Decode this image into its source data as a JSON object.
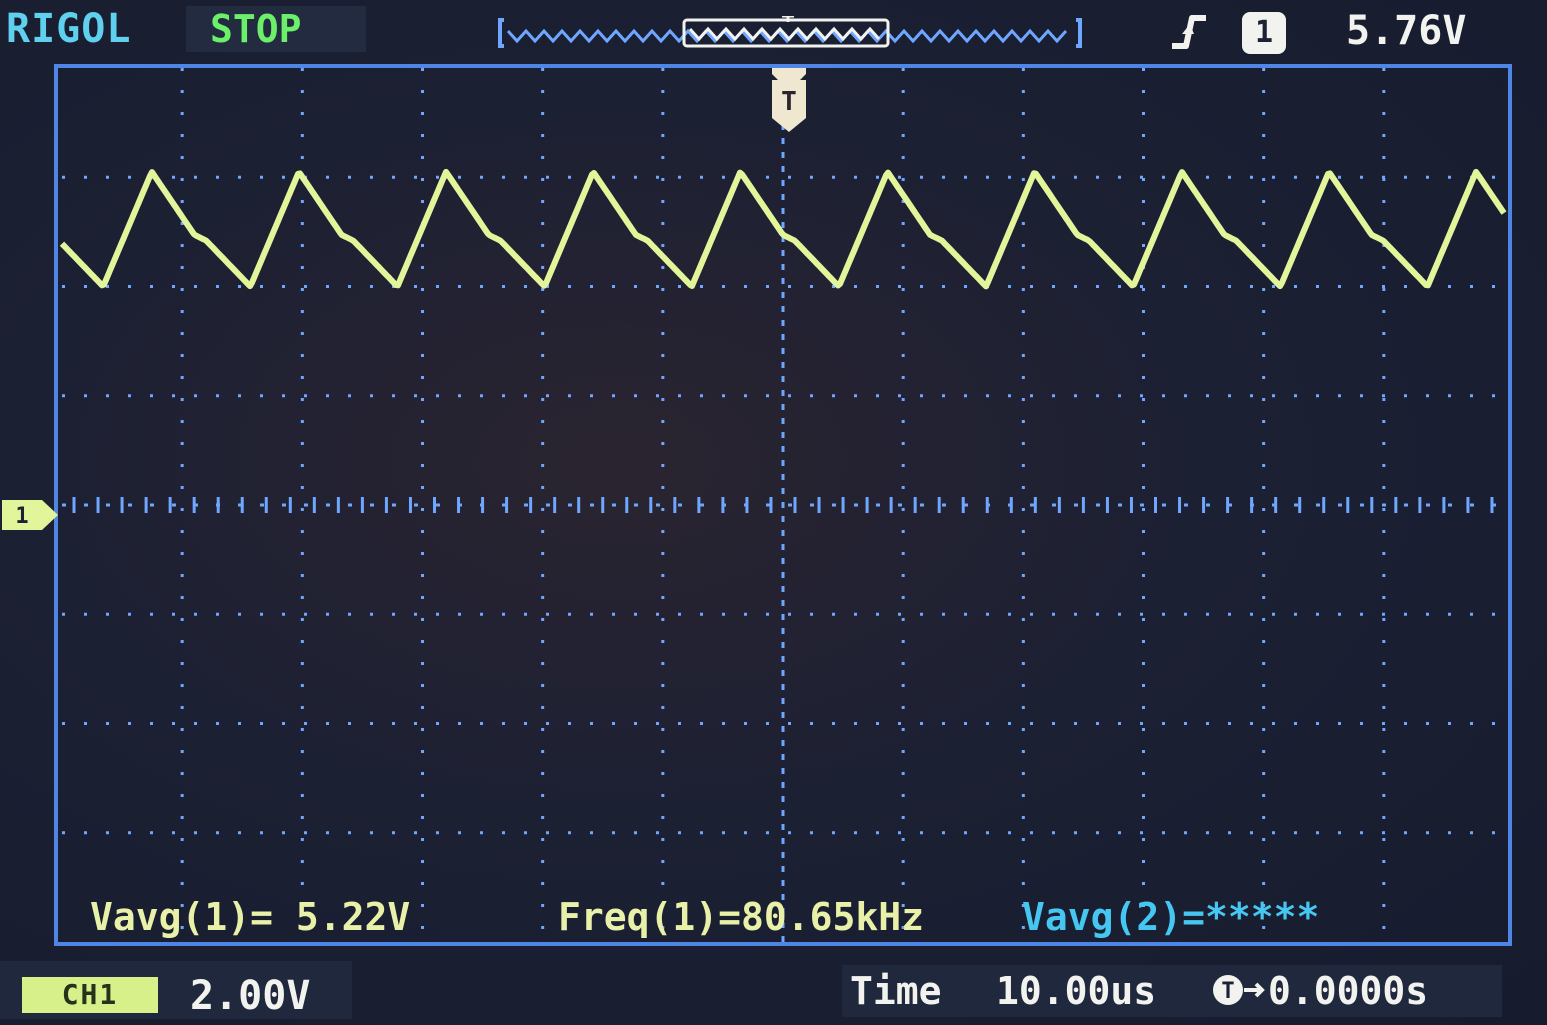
{
  "header": {
    "brand": "RIGOL",
    "run_state": "STOP",
    "trigger_channel": "1",
    "trigger_level": "5.76V",
    "trigger_edge_icon": "rising-edge-icon"
  },
  "display": {
    "channel_marker": "1",
    "trigger_marker": "T",
    "trace_color": "#e3f59a",
    "grid_color": "#6fa6ff",
    "frame_color": "#4f86e6",
    "waveform": {
      "channel": "CH1",
      "shape": "triangle-ripple",
      "peak_div": 3.05,
      "trough_div": 2.0,
      "cycles_on_screen": 10
    }
  },
  "measurements": {
    "vavg1": "Vavg(1)= 5.22V",
    "freq1": "Freq(1)=80.65kHz",
    "vavg2": "Vavg(2)=*****"
  },
  "footer": {
    "channel_tag": "CH1",
    "volts_per_div": "2.00V",
    "time_label": "Time",
    "time_per_div": "10.00us",
    "trigger_offset": "0.0000s"
  },
  "colors": {
    "brand": "#5fd0ee",
    "run_state": "#6cf06a",
    "ch1": "#e9f0a8",
    "ch2": "#45c7f2"
  }
}
